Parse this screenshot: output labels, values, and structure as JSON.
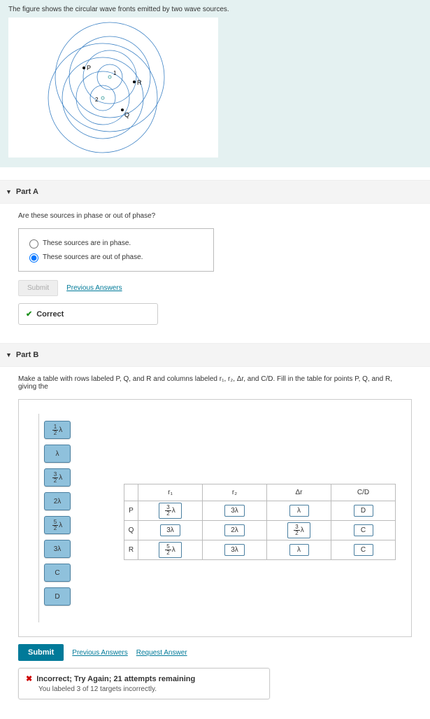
{
  "figure": {
    "caption": "The figure shows the circular wave fronts emitted by two wave sources.",
    "labels": {
      "p": "P",
      "r": "R",
      "q": "Q",
      "s1": "1",
      "s2": "2"
    }
  },
  "partA": {
    "title": "Part A",
    "question": "Are these sources in phase or out of phase?",
    "options": [
      {
        "label": "These sources are in phase.",
        "selected": false
      },
      {
        "label": "These sources are out of phase.",
        "selected": true
      }
    ],
    "submit": "Submit",
    "prevAnswers": "Previous Answers",
    "statusLabel": "Correct"
  },
  "partB": {
    "title": "Part B",
    "instruction": "Make a table with rows labeled P, Q, and R and columns labeled r₁, r₂, Δr, and C/D. Fill in the table for points P, Q, and R, giving the",
    "chips": [
      "½λ",
      "λ",
      "³⁄₂λ",
      "2λ",
      "⁵⁄₂λ",
      "3λ",
      "C",
      "D"
    ],
    "headers": {
      "r1": "r₁",
      "r2": "r₂",
      "dr": "Δr",
      "cd": "C/D"
    },
    "rows": [
      {
        "h": "P",
        "r1": "³⁄₂λ",
        "r2": "3λ",
        "dr": "λ",
        "cd": "D"
      },
      {
        "h": "Q",
        "r1": "3λ",
        "r2": "2λ",
        "dr": "³⁄₂λ",
        "cd": "C"
      },
      {
        "h": "R",
        "r1": "⁵⁄₂λ",
        "r2": "3λ",
        "dr": "λ",
        "cd": "C"
      }
    ],
    "submit": "Submit",
    "prevAnswers": "Previous Answers",
    "reqAnswer": "Request Answer",
    "incorrectHead": "Incorrect; Try Again; 21 attempts remaining",
    "incorrectSub": "You labeled 3 of 12 targets incorrectly."
  },
  "chart_data": {
    "type": "table",
    "title": "Wave interference path differences",
    "columns": [
      "r1",
      "r2",
      "Δr",
      "C/D"
    ],
    "rows": {
      "P": [
        "3/2 λ",
        "3λ",
        "λ",
        "D"
      ],
      "Q": [
        "3λ",
        "2λ",
        "3/2 λ",
        "C"
      ],
      "R": [
        "5/2 λ",
        "3λ",
        "λ",
        "C"
      ]
    }
  }
}
